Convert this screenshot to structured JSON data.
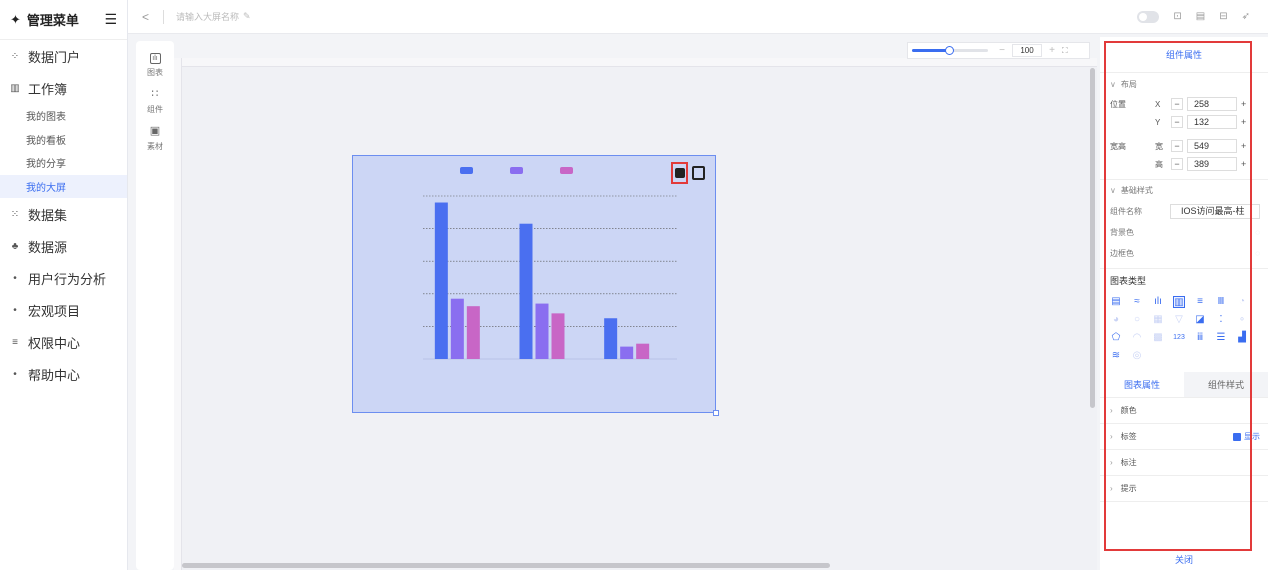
{
  "sidebar": {
    "title": "管理菜单",
    "items": [
      {
        "icon": "grid-dots-icon",
        "glyph": "⁘",
        "label": "数据门户"
      },
      {
        "icon": "bar-chart-icon",
        "glyph": "▥",
        "label": "工作簿"
      }
    ],
    "sub_items": [
      "我的图表",
      "我的看板",
      "我的分享",
      "我的大屏"
    ],
    "items2": [
      {
        "icon": "scatter-icon",
        "glyph": "⁙",
        "label": "数据集"
      },
      {
        "icon": "cluster-icon",
        "glyph": "♣",
        "label": "数据源"
      },
      {
        "icon": "dot-icon",
        "glyph": "•",
        "label": "用户行为分析"
      },
      {
        "icon": "dot-icon",
        "glyph": "•",
        "label": "宏观项目"
      },
      {
        "icon": "list-icon",
        "glyph": "≡",
        "label": "权限中心"
      },
      {
        "icon": "dot-icon",
        "glyph": "•",
        "label": "帮助中心"
      }
    ]
  },
  "topbar": {
    "name_placeholder": "请输入大屏名称"
  },
  "tools": [
    {
      "icon": "chart-icon",
      "glyph": "ılı",
      "label": "图表"
    },
    {
      "icon": "component-icon",
      "glyph": "∷",
      "label": "组件"
    },
    {
      "icon": "image-icon",
      "glyph": "▣",
      "label": "素材"
    }
  ],
  "zoom": {
    "value": "100",
    "level": 0.5
  },
  "chart_data": {
    "type": "bar",
    "categories": [
      "",
      "",
      ""
    ],
    "series": [
      {
        "name": "",
        "color": "#4a6ff0",
        "values": [
          4800,
          4150,
          1250
        ]
      },
      {
        "name": "",
        "color": "#8a6ef0",
        "values": [
          1850,
          1700,
          380
        ]
      },
      {
        "name": "",
        "color": "#c866c6",
        "values": [
          1620,
          1400,
          470
        ]
      }
    ],
    "ylim": [
      0,
      5000
    ],
    "grid": true,
    "legend_position": "top"
  },
  "props": {
    "title": "组件属性",
    "layout_section": "布局",
    "position_label": "位置",
    "x_label": "X",
    "x_value": "258",
    "y_label": "Y",
    "y_value": "132",
    "size_label": "宽高",
    "w_label": "宽",
    "w_value": "549",
    "h_label": "高",
    "h_value": "389",
    "basic_section": "基础样式",
    "name_label": "组件名称",
    "name_value": "IOS访问最高-柱",
    "bg_label": "背景色",
    "border_label": "边框色",
    "chart_type_title": "图表类型",
    "tab_chart": "图表属性",
    "tab_style": "组件样式",
    "collapse_items": [
      "颜色",
      "标签",
      "标注",
      "提示"
    ],
    "label_show": "显示",
    "close": "关闭"
  }
}
